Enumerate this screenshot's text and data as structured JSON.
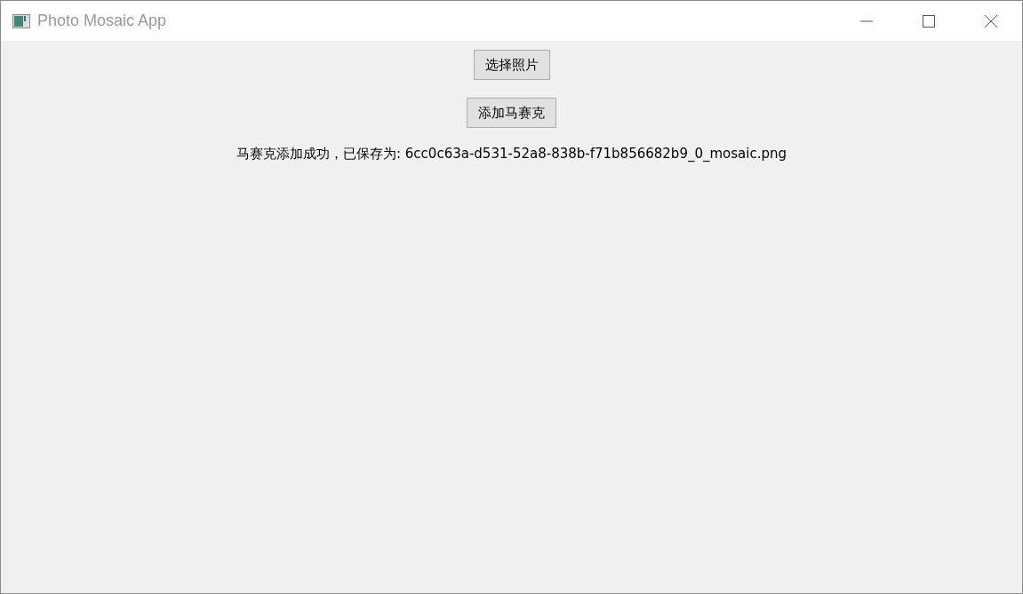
{
  "window": {
    "title": "Photo Mosaic App",
    "active": false
  },
  "buttons": [
    {
      "label": "选择照片"
    },
    {
      "label": "添加马赛克"
    }
  ],
  "status_label": "马赛克添加成功，已保存为: 6cc0c63a-d531-52a8-838b-f71b856682b9_0_mosaic.png"
}
